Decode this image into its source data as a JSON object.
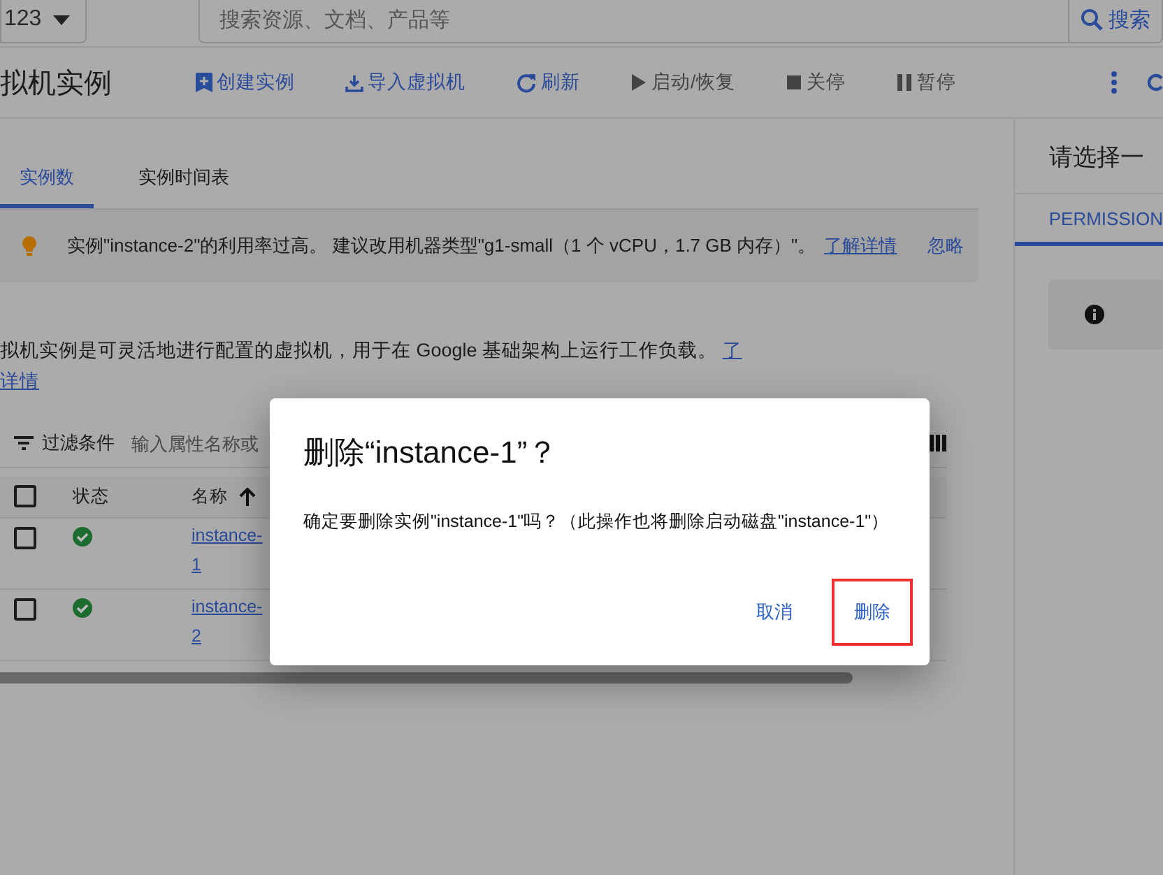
{
  "project_selector": {
    "label": "123"
  },
  "search": {
    "placeholder": "搜索资源、文档、产品等",
    "button": "搜索"
  },
  "page_title": "拟机实例",
  "toolbar": [
    {
      "kind": "create",
      "label": "创建实例",
      "disabled": false
    },
    {
      "kind": "import",
      "label": "导入虚拟机",
      "disabled": false
    },
    {
      "kind": "refresh",
      "label": "刷新",
      "disabled": false
    },
    {
      "kind": "start",
      "label": "启动/恢复",
      "disabled": true
    },
    {
      "kind": "stop",
      "label": "关停",
      "disabled": true
    },
    {
      "kind": "pause",
      "label": "暂停",
      "disabled": true
    }
  ],
  "tabs": [
    {
      "label": "实例数",
      "selected": true
    },
    {
      "label": "实例时间表",
      "selected": false
    }
  ],
  "notice": {
    "text": "实例\"instance-2\"的利用率过高。 建议改用机器类型\"g1-small（1 个 vCPU，1.7 GB 内存）\"。",
    "link": "了解详情",
    "dismiss": "忽略"
  },
  "description": {
    "text": "拟机实例是可灵活地进行配置的虚拟机，用于在 Google 基础架构上运行工作负载。",
    "link_start": "了",
    "link_end": "详情"
  },
  "filter": {
    "label": "过滤条件",
    "placeholder": "输入属性名称或"
  },
  "table": {
    "all_checked": false,
    "columns": [
      {
        "label": "状态",
        "sorted": false
      },
      {
        "label": "名称",
        "sorted": true
      }
    ],
    "rows": [
      {
        "checked": false,
        "healthy": true,
        "name": "instance-1"
      },
      {
        "checked": false,
        "healthy": true,
        "name": "instance-2"
      }
    ]
  },
  "side_panel": {
    "title": "请选择一",
    "tab": "PERMISSION"
  },
  "dialog": {
    "title": "删除“instance-1”？",
    "message": "确定要删除实例\"instance-1\"吗？（此操作也将删除启动磁盘\"instance-1\"）",
    "buttons": [
      {
        "label": "取消",
        "highlighted": false
      },
      {
        "label": "删除",
        "highlighted": true
      }
    ]
  }
}
